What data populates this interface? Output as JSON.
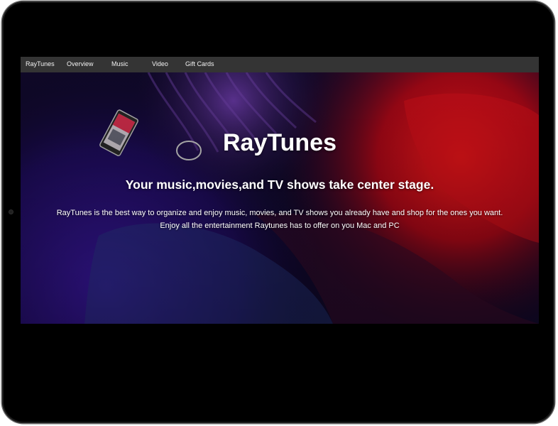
{
  "nav": {
    "brand": "RayTunes",
    "items": [
      {
        "label": "Overview"
      },
      {
        "label": "Music"
      },
      {
        "label": "Video"
      },
      {
        "label": "Gift Cards"
      }
    ]
  },
  "hero": {
    "title": "RayTunes",
    "subtitle": "Your music,movies,and TV shows take center stage.",
    "description": "RayTunes is the best way to organize and enjoy music, movies, and TV shows you already have and shop for the ones you want. Enjoy all the entertainment Raytunes has to offer on you Mac and PC"
  },
  "colors": {
    "device_frame": "#000000",
    "navbar_bg": "#343434",
    "hero_accent_red": "#e0101c",
    "hero_accent_purple": "#3a1a9a"
  }
}
